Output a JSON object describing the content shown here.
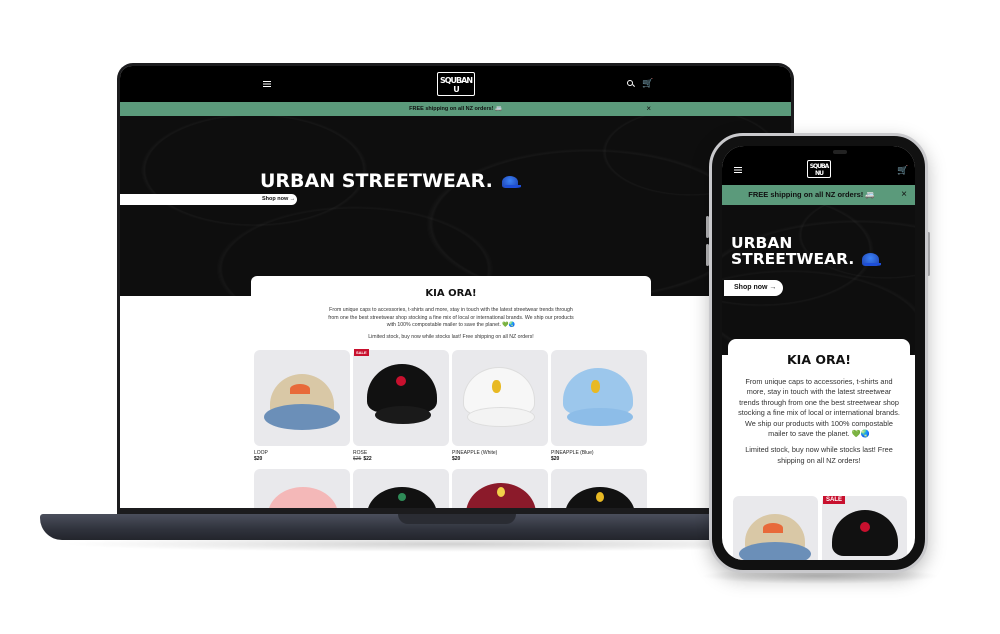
{
  "brand": {
    "logo_text": "SQUBANU"
  },
  "announcement": {
    "text": "FREE shipping on all NZ orders! 🚐",
    "close": "×"
  },
  "hero": {
    "title": "URBAN STREETWEAR.",
    "button": "Shop now →"
  },
  "intro": {
    "title": "KIA ORA!",
    "paragraph": "From unique caps to accessories, t-shirts and more, stay in touch with the latest streetwear trends through from one the best streetwear shop stocking a fine mix of local or international brands. We ship our products with 100% compostable mailer to save the planet. 💚🌏",
    "stock_note": "Limited stock, buy now while stocks last! Free shipping on all NZ orders!"
  },
  "products": [
    {
      "name": "LOOP",
      "price": "$20",
      "old_price": "",
      "sale": false
    },
    {
      "name": "ROSE",
      "price": "$22",
      "old_price": "$25",
      "sale": true,
      "badge": "SALE"
    },
    {
      "name": "PINEAPPLE (White)",
      "price": "$20",
      "old_price": "",
      "sale": false
    },
    {
      "name": "PINEAPPLE (Blue)",
      "price": "$20",
      "old_price": "",
      "sale": false
    }
  ],
  "icons": {
    "menu": "hamburger-icon",
    "search": "search-icon",
    "cart": "cart-icon",
    "close": "close-icon"
  },
  "colors": {
    "header_bg": "#000000",
    "announcement_bg": "#5b9a7b",
    "sale_badge": "#c8102e",
    "product_bg": "#e9e9ec"
  }
}
